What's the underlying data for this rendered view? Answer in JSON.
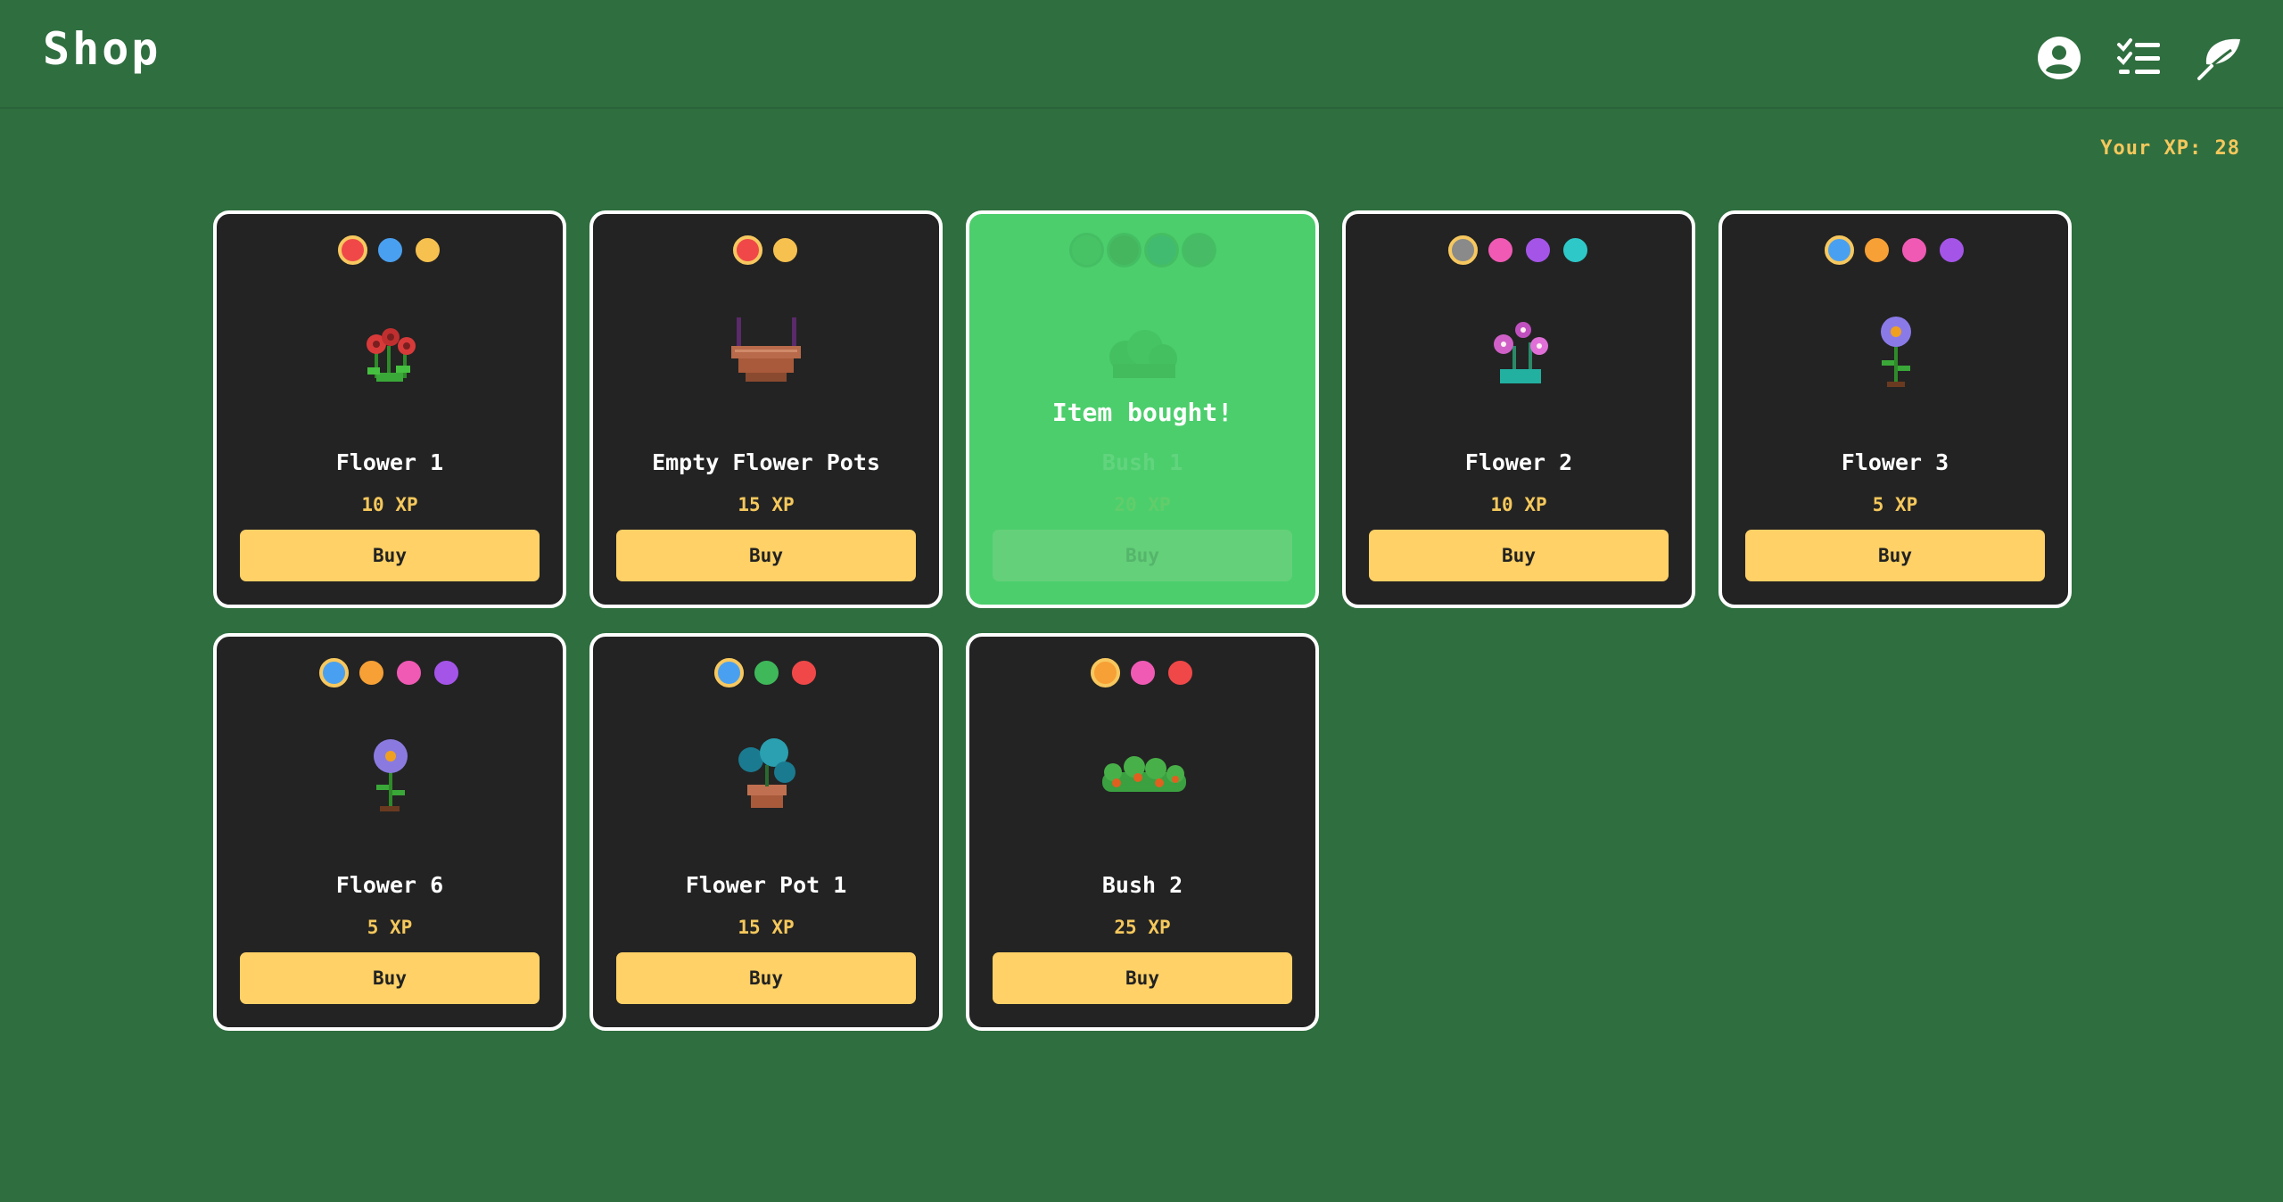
{
  "header": {
    "title": "Shop"
  },
  "icons": {
    "profile": "user-circle-icon",
    "tasks": "checklist-icon",
    "garden": "leaf-icon"
  },
  "xp": {
    "label": "Your XP: 28"
  },
  "colors": {
    "background": "#2f6e3f",
    "card": "#232323",
    "bought_card": "#4cce6c",
    "accent": "#ffd166",
    "price": "#f5c85c"
  },
  "items": [
    {
      "name": "Flower 1",
      "price": "10 XP",
      "button": "Buy",
      "image": "red-flowers-icon",
      "bought": false,
      "colors": [
        "#f04848",
        "#4aa0f0",
        "#f7c14f"
      ],
      "selected_color": 0
    },
    {
      "name": "Empty Flower Pots",
      "price": "15 XP",
      "button": "Buy",
      "image": "hanging-pot-icon",
      "bought": false,
      "colors": [
        "#f04848",
        "#f7c14f"
      ],
      "selected_color": 0
    },
    {
      "name": "Bush 1",
      "price": "20 XP",
      "button": "Buy",
      "image": "bush-icon",
      "bought": true,
      "status": "Item bought!",
      "colors": [
        "#3fae5a",
        "#3a8a44",
        "#2f9a78",
        "#3e9a5a"
      ],
      "selected_color": 0
    },
    {
      "name": "Flower 2",
      "price": "10 XP",
      "button": "Buy",
      "image": "pink-flowers-icon",
      "bought": false,
      "colors": [
        "#8a8a8a",
        "#f05ab4",
        "#a455e8",
        "#2ec8c8"
      ],
      "selected_color": 0
    },
    {
      "name": "Flower 3",
      "price": "5 XP",
      "button": "Buy",
      "image": "purple-flower-icon",
      "bought": false,
      "colors": [
        "#4aa0f0",
        "#f7a035",
        "#f05ab4",
        "#a455e8"
      ],
      "selected_color": 0
    },
    {
      "name": "Flower 6",
      "price": "5 XP",
      "button": "Buy",
      "image": "lavender-flower-icon",
      "bought": false,
      "colors": [
        "#4aa0f0",
        "#f7a035",
        "#f05ab4",
        "#a455e8"
      ],
      "selected_color": 0
    },
    {
      "name": "Flower Pot 1",
      "price": "15 XP",
      "button": "Buy",
      "image": "potted-plant-icon",
      "bought": false,
      "colors": [
        "#4aa0f0",
        "#3fb85a",
        "#f04848"
      ],
      "selected_color": 0
    },
    {
      "name": "Bush 2",
      "price": "25 XP",
      "button": "Buy",
      "image": "berry-bush-icon",
      "bought": false,
      "colors": [
        "#f7a035",
        "#f05ab4",
        "#f04848"
      ],
      "selected_color": 0
    }
  ]
}
